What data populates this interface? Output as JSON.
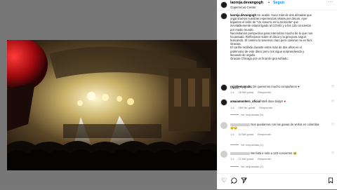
{
  "post": {
    "username": "laoreja.devangogh",
    "follow_label": "Seguir",
    "location": "Copernicus Center",
    "caption_user": "laoreja.devangogh",
    "caption_lines": [
      "Se acabó. Hace más de dos décadas que",
      "organizamos nuestras experiencias vitales por discos. Ayer",
      "bajamos el telón de \"Un susurro en la tormenta\" que",
      "inevitablemente estará ligado al COVID y a los 125 conciertos",
      "por medio mundo.",
      "Necesitamos perspectiva para interiorizar mucho de lo que nos",
      "ha pasado. Reflexionar sobre el disco y la gira para seguir",
      "buscando. El camino lo tenemos claro pero caminar no es fácil.",
      "Gracias.",
      "El cariño recibido durante estos más de dos años es el",
      "patrimonio de este disco pero nos sigue sorprendiendo y",
      "llenando de orgullo.",
      "Gracias Chicago por un final de gira soñado."
    ],
    "edited_label": "Editado",
    "caption_time": "1 d"
  },
  "comments": [
    {
      "user": "rojaldemamabc",
      "text": "Os queremos mucho compañeros",
      "emoji": "♥",
      "time": "1 d",
      "likes": "18 Me gusta",
      "reply": "Responder"
    },
    {
      "user": "amaiamontero_oficial",
      "text": "Well done baby!!",
      "emoji": "♥",
      "time": "1 d",
      "likes": "186 Me gusta",
      "reply": "Responder",
      "replies": "Ver respuestas (9)"
    },
    {
      "user": "",
      "text": "Nos quedamos con las ganas de verlos en colombia",
      "emoji": "😢😢",
      "time": "1 d",
      "likes": "10 Me gusta",
      "reply": "Responder",
      "replies": "Ver respuestas (1)"
    },
    {
      "user": "",
      "text": "Me faltó ir solo a 122 conciertos",
      "emoji": "😂",
      "time": "1 d",
      "likes": "12 Me gusta",
      "reply": "Responder",
      "replies": "Ver respuestas (2)"
    }
  ],
  "icons": {
    "more": "more-options-icon",
    "heart": "heart-icon",
    "comment": "comment-icon",
    "share": "share-icon",
    "save": "bookmark-icon"
  },
  "colors": {
    "accent": "#0095f6",
    "stage_light": "#f6e9a0"
  }
}
